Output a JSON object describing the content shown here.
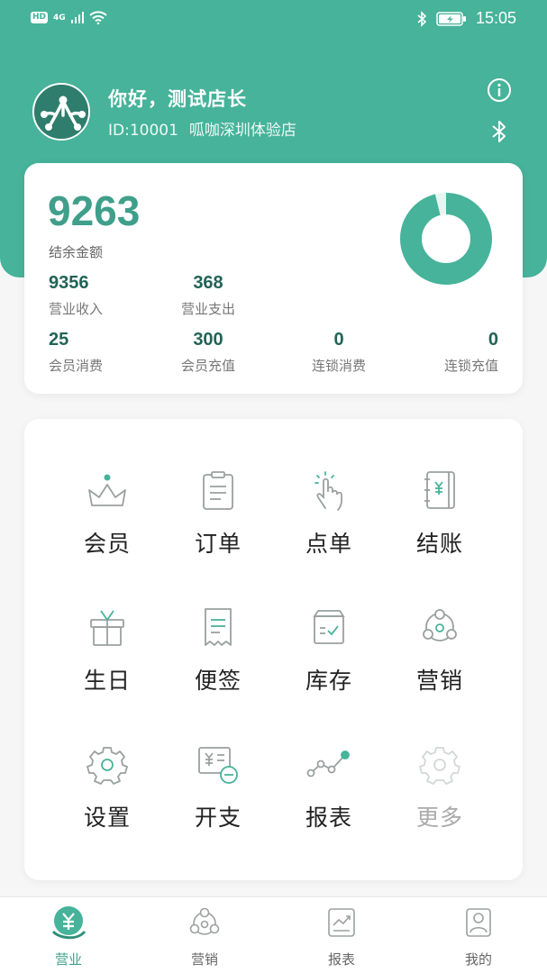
{
  "status_bar": {
    "hd": "HD",
    "network": "4G",
    "time": "15:05"
  },
  "profile": {
    "greeting": "你好，测试店长",
    "store_id": "ID:10001",
    "store_name": "呱咖深圳体验店"
  },
  "summary": {
    "balance_value": "9263",
    "balance_label": "结余金额",
    "stats": [
      {
        "value": "9356",
        "label": "营业收入"
      },
      {
        "value": "368",
        "label": "营业支出"
      },
      {
        "value": "25",
        "label": "会员消费"
      },
      {
        "value": "300",
        "label": "会员充值"
      },
      {
        "value": "0",
        "label": "连锁消费"
      },
      {
        "value": "0",
        "label": "连锁充值"
      }
    ],
    "donut_fraction": 0.96
  },
  "menu": {
    "items": [
      {
        "label": "会员",
        "icon": "crown-icon"
      },
      {
        "label": "订单",
        "icon": "clipboard-icon"
      },
      {
        "label": "点单",
        "icon": "tap-hand-icon"
      },
      {
        "label": "结账",
        "icon": "ledger-yuan-icon"
      },
      {
        "label": "生日",
        "icon": "gift-icon"
      },
      {
        "label": "便签",
        "icon": "receipt-icon"
      },
      {
        "label": "库存",
        "icon": "inventory-box-icon"
      },
      {
        "label": "营销",
        "icon": "share-nodes-icon"
      },
      {
        "label": "设置",
        "icon": "gear-icon"
      },
      {
        "label": "开支",
        "icon": "expense-bill-icon"
      },
      {
        "label": "报表",
        "icon": "line-chart-icon"
      },
      {
        "label": "更多",
        "icon": "more-gear-icon"
      }
    ]
  },
  "tab_bar": {
    "tabs": [
      {
        "label": "营业",
        "icon": "business-yuan-icon",
        "active": true
      },
      {
        "label": "营销",
        "icon": "marketing-nodes-icon",
        "active": false
      },
      {
        "label": "报表",
        "icon": "report-chart-icon",
        "active": false
      },
      {
        "label": "我的",
        "icon": "profile-person-icon",
        "active": false
      }
    ]
  },
  "colors": {
    "primary": "#46b39a",
    "primary_dark": "#226356",
    "icon_gray": "#9aa0a0"
  }
}
